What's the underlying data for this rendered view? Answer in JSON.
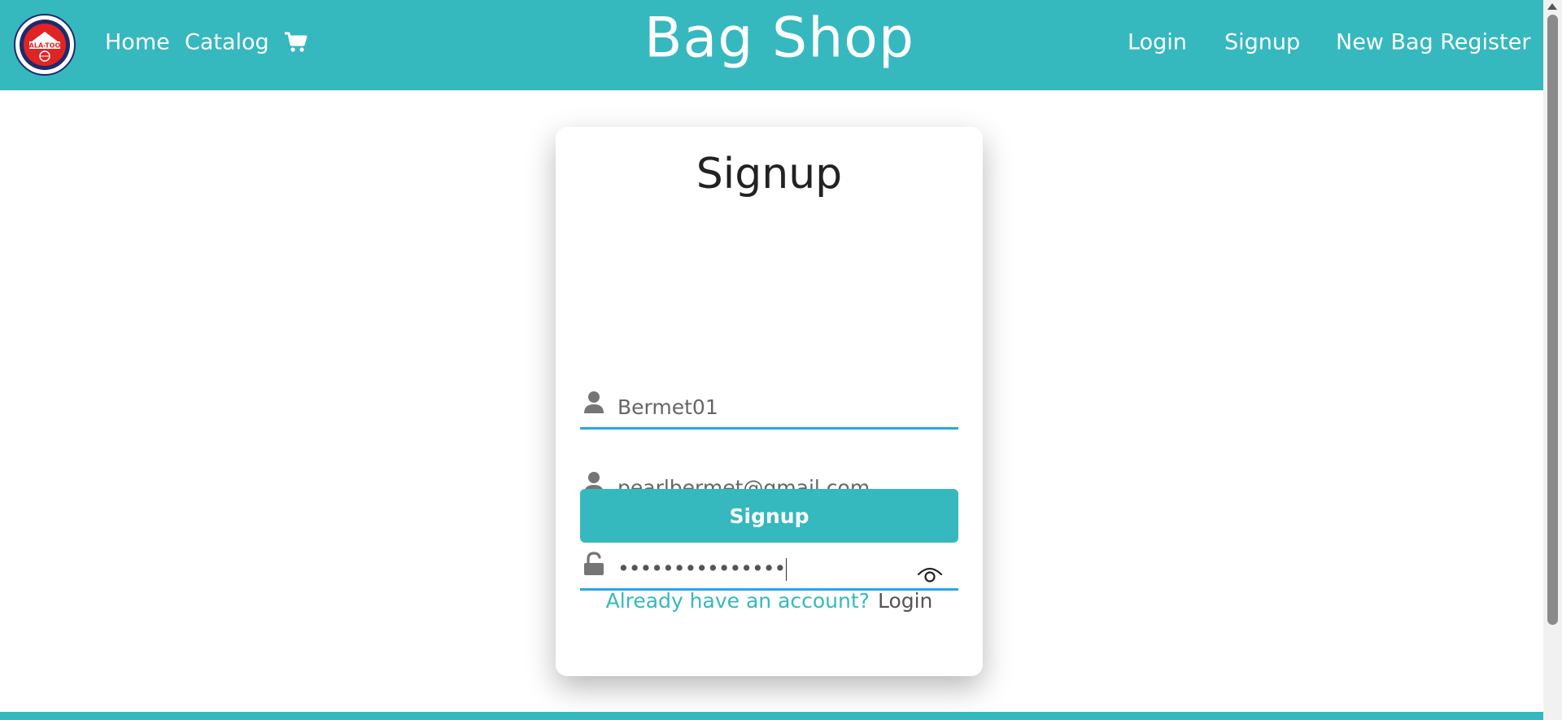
{
  "header": {
    "logo_icon": "ala-too-university-logo",
    "logo_text": "ALA-TOO",
    "nav_left": [
      {
        "label": "Home"
      },
      {
        "label": "Catalog"
      }
    ],
    "cart_icon": "shopping-cart-icon",
    "brand": "Bag Shop",
    "nav_right": [
      {
        "label": "Login"
      },
      {
        "label": "Signup"
      },
      {
        "label": "New Bag Register"
      }
    ]
  },
  "form": {
    "title": "Signup",
    "username": {
      "icon": "user-icon",
      "value": "Bermet01"
    },
    "email": {
      "icon": "user-icon",
      "value": "pearlbermet@gmail.com"
    },
    "password": {
      "icon": "lock-icon",
      "value": "•••••••••••••••",
      "toggle_icon": "eye-icon"
    },
    "submit_label": "Signup",
    "already_text": "Already have an account?",
    "login_label": "Login"
  },
  "colors": {
    "brand": "#36b8bf",
    "field_underline": "#2aa7df",
    "text_muted": "#666666"
  }
}
